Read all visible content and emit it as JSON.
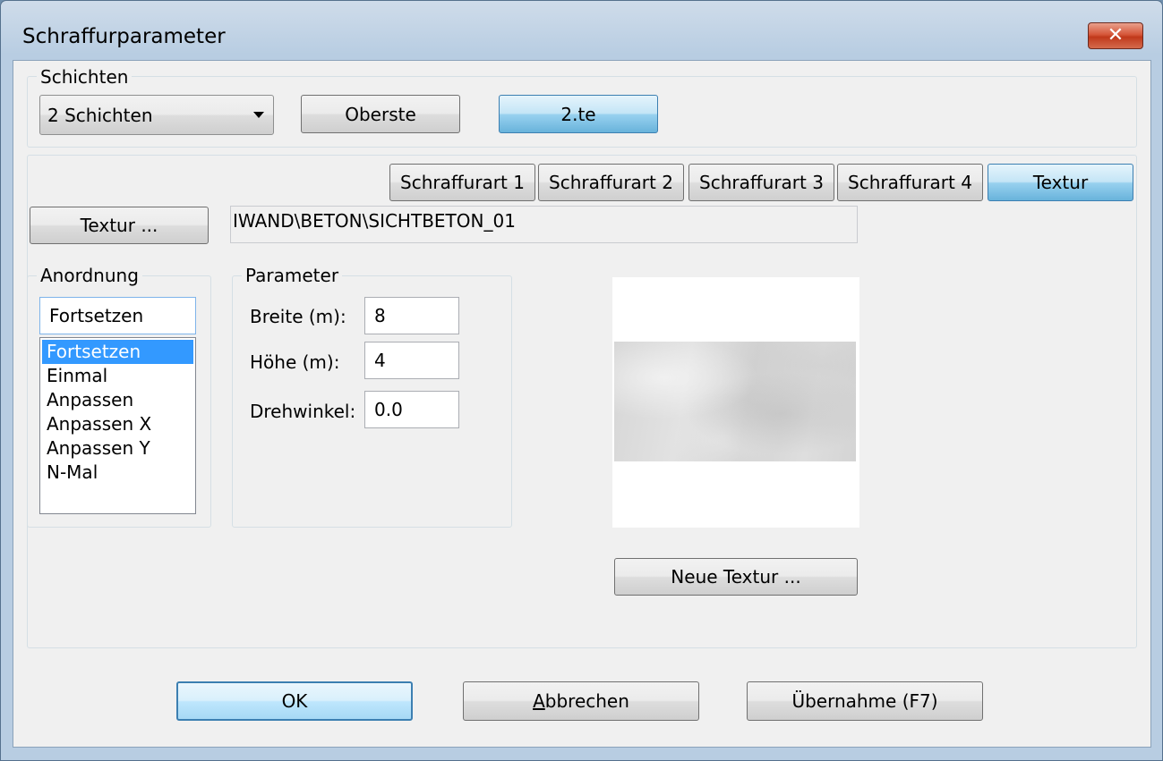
{
  "window": {
    "title": "Schraffurparameter",
    "close_glyph": "✕"
  },
  "schichten": {
    "group_label": "Schichten",
    "combo_value": "2 Schichten",
    "oberste_label": "Oberste",
    "zweite_label": "2.te"
  },
  "tabs": [
    {
      "label": "Schraffurart 1"
    },
    {
      "label": "Schraffurart 2"
    },
    {
      "label": "Schraffurart 3"
    },
    {
      "label": "Schraffurart 4"
    },
    {
      "label": "Textur",
      "selected": true
    }
  ],
  "textur": {
    "button_label": "Textur ...",
    "path": "IWAND\\BETON\\SICHTBETON_01",
    "new_texture_label": "Neue Textur ..."
  },
  "anordnung": {
    "group_label": "Anordnung",
    "current_value": "Fortsetzen",
    "options": [
      "Fortsetzen",
      "Einmal",
      "Anpassen",
      "Anpassen X",
      "Anpassen Y",
      "N-Mal"
    ],
    "selected_index": 0
  },
  "parameter": {
    "group_label": "Parameter",
    "breite_label": "Breite (m):",
    "breite_value": "8",
    "hoehe_label": "Höhe (m):",
    "hoehe_value": "4",
    "drehwinkel_label": "Drehwinkel:",
    "drehwinkel_value": "0.0"
  },
  "footer": {
    "ok_label": "OK",
    "cancel_label_first": "A",
    "cancel_label_rest": "bbrechen",
    "apply_label": "Übernahme (F7)"
  },
  "colors": {
    "selection": "#3399ff",
    "close_red": "#c0391b",
    "focus_blue": "#3c7fb1"
  }
}
